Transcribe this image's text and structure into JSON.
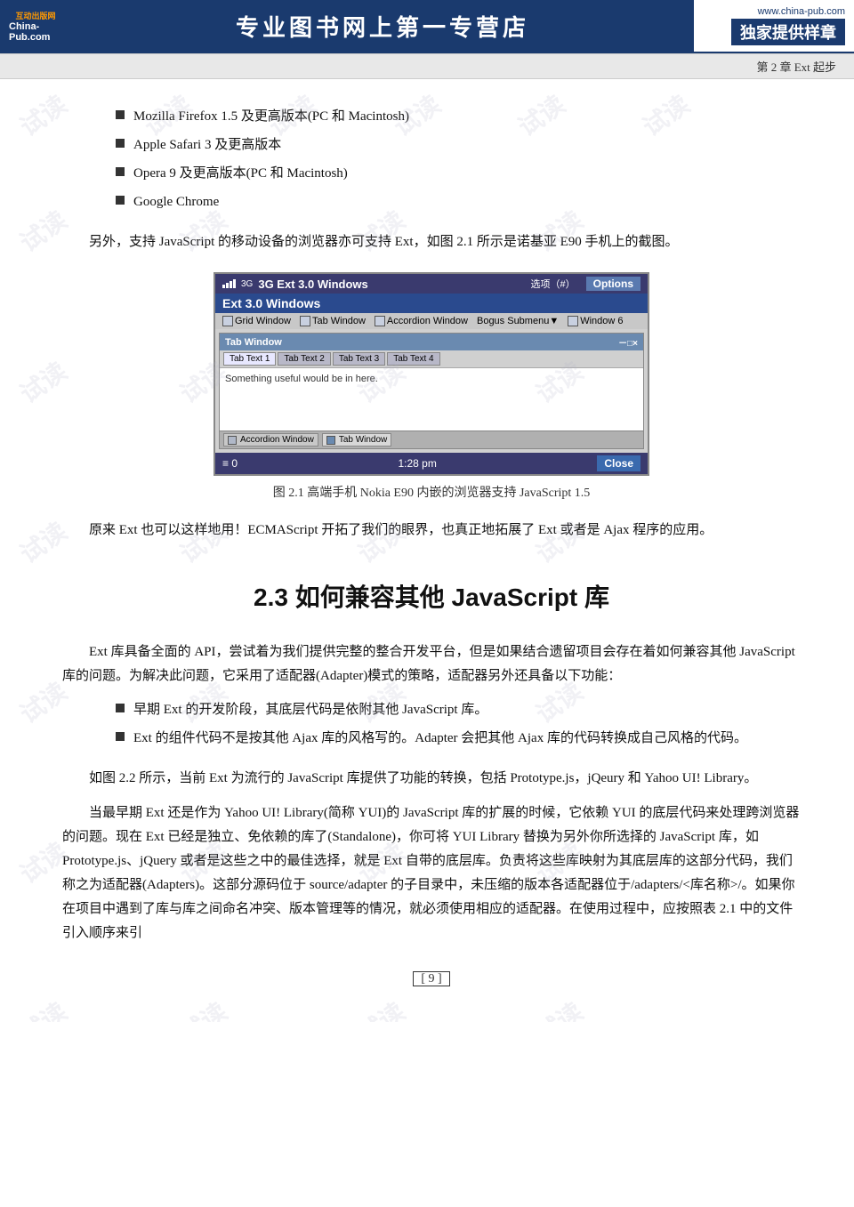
{
  "header": {
    "logo_top": "互动出版网",
    "logo_main": "China-Pub.com",
    "title": "专业图书网上第一专营店",
    "url": "www.china-pub.com",
    "sample": "独家提供样章"
  },
  "chapter_bar": {
    "text": "第 2 章   Ext 起步"
  },
  "bullets": [
    "Mozilla Firefox 1.5 及更高版本(PC 和 Macintosh)",
    "Apple Safari 3 及更高版本",
    "Opera 9 及更高版本(PC 和 Macintosh)",
    "Google Chrome"
  ],
  "para1": "另外，支持 JavaScript 的移动设备的浏览器亦可支持 Ext，如图 2.1 所示是诺基亚 E90 手机上的截图。",
  "figure": {
    "caption": "图 2.1    高端手机 Nokia E90 内嵌的浏览器支持 JavaScript 1.5",
    "phone_top_label": "3G  Ext 3.0 Windows",
    "phone_status": "选项（#）",
    "phone_options": "Options",
    "phone_section_title": "Ext 3.0 Windows",
    "menu_items": [
      "Grid Window",
      "Tab Window",
      "Accordion Window",
      "Bogus Submenu▼",
      "Window 6"
    ],
    "tab_window_title": "Tab Window",
    "tab_window_controls": "－□×",
    "tabs": [
      "Tab Text 1",
      "Tab Text 2",
      "Tab Text 3",
      "Tab Text 4"
    ],
    "tab_content": "Something useful would be in here.",
    "accordion_items": [
      "Accordion Window",
      "Tab Window"
    ],
    "bottom_left": "≡  0",
    "bottom_time": "1:28 pm",
    "bottom_right": "Close"
  },
  "para2": "原来 Ext 也可以这样地用！ECMAScript 开拓了我们的眼界，也真正地拓展了 Ext 或者是 Ajax 程序的应用。",
  "section_heading": "2.3    如何兼容其他 JavaScript 库",
  "para3": "Ext 库具备全面的 API，尝试着为我们提供完整的整合开发平台，但是如果结合遗留项目会存在着如何兼容其他 JavaScript 库的问题。为解决此问题，它采用了适配器(Adapter)模式的策略，适配器另外还具备以下功能：",
  "bullets2": [
    "早期 Ext 的开发阶段，其底层代码是依附其他 JavaScript 库。",
    "Ext 的组件代码不是按其他 Ajax 库的风格写的。Adapter 会把其他 Ajax 库的代码转换成自己风格的代码。"
  ],
  "para4": "如图 2.2 所示，当前 Ext 为流行的 JavaScript 库提供了功能的转换，包括 Prototype.js，jQeury 和 Yahoo UI! Library。",
  "para5": "当最早期 Ext 还是作为 Yahoo UI! Library(简称 YUI)的 JavaScript 库的扩展的时候，它依赖 YUI 的底层代码来处理跨浏览器的问题。现在 Ext 已经是独立、免依赖的库了(Standalone)，你可将 YUI Library 替换为另外你所选择的 JavaScript 库，如 Prototype.js、jQuery 或者是这些之中的最佳选择，就是 Ext 自带的底层库。负责将这些库映射为其底层库的这部分代码，我们称之为适配器(Adapters)。这部分源码位于 source/adapter 的子目录中，未压缩的版本各适配器位于/adapters/<库名称>/。如果你在项目中遇到了库与库之间命名冲突、版本管理等的情况，就必须使用相应的适配器。在使用过程中，应按照表 2.1 中的文件引入顺序来引",
  "page_number": "9",
  "watermark_text": "试读"
}
